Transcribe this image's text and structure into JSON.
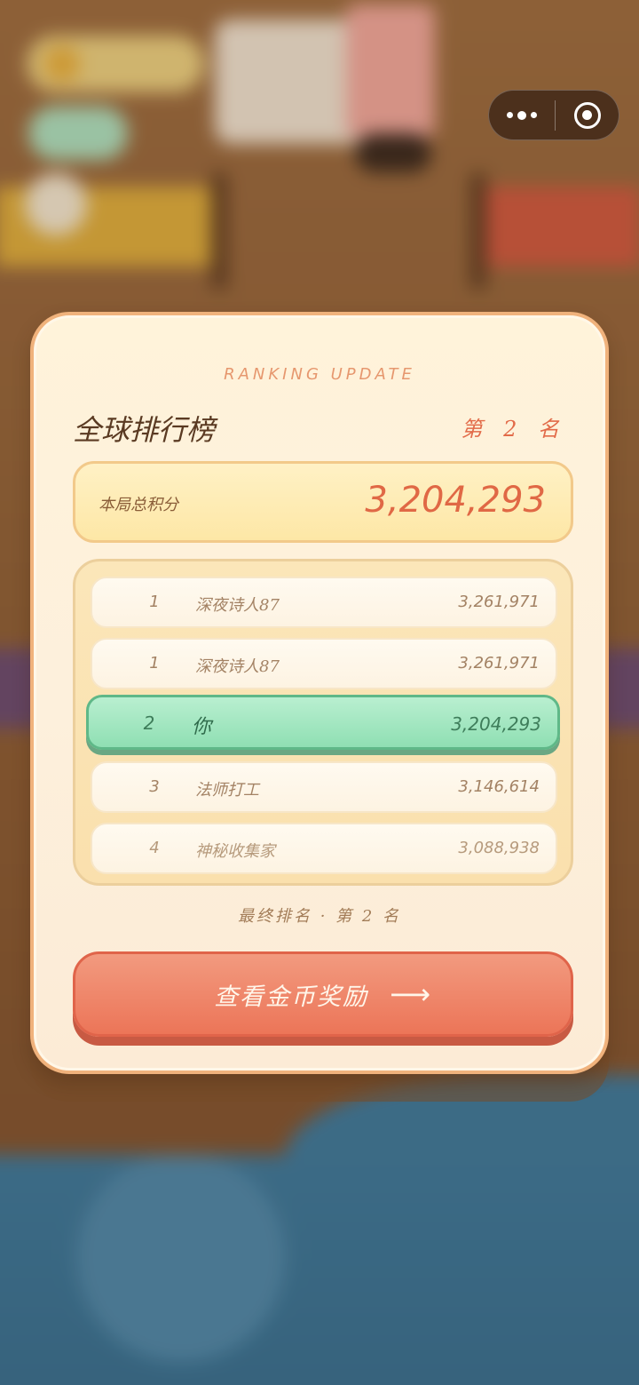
{
  "modal": {
    "subtitle": "RANKING UPDATE",
    "title": "全球排行榜",
    "rank_badge": "第 2 名",
    "score_label": "本局总积分",
    "score_value": "3,204,293",
    "leaderboard": [
      {
        "rank": "1",
        "name": "深夜诗人87",
        "score": "3,261,971",
        "is_self": false
      },
      {
        "rank": "1",
        "name": "深夜诗人87",
        "score": "3,261,971",
        "is_self": false
      },
      {
        "rank": "2",
        "name": "你",
        "score": "3,204,293",
        "is_self": true
      },
      {
        "rank": "3",
        "name": "法师打工",
        "score": "3,146,614",
        "is_self": false
      },
      {
        "rank": "4",
        "name": "神秘收集家",
        "score": "3,088,938",
        "is_self": false
      }
    ],
    "final_rank_text": "最终排名 · 第 2 名",
    "cta_label": "查看金币奖励",
    "cta_arrow": "⟶"
  },
  "capsule": {
    "more_icon": "more-dots-icon",
    "close_icon": "target-close-icon"
  },
  "colors": {
    "accent": "#e26b49",
    "self_row": "#9fe6c0",
    "cta": "#ee7f62"
  }
}
